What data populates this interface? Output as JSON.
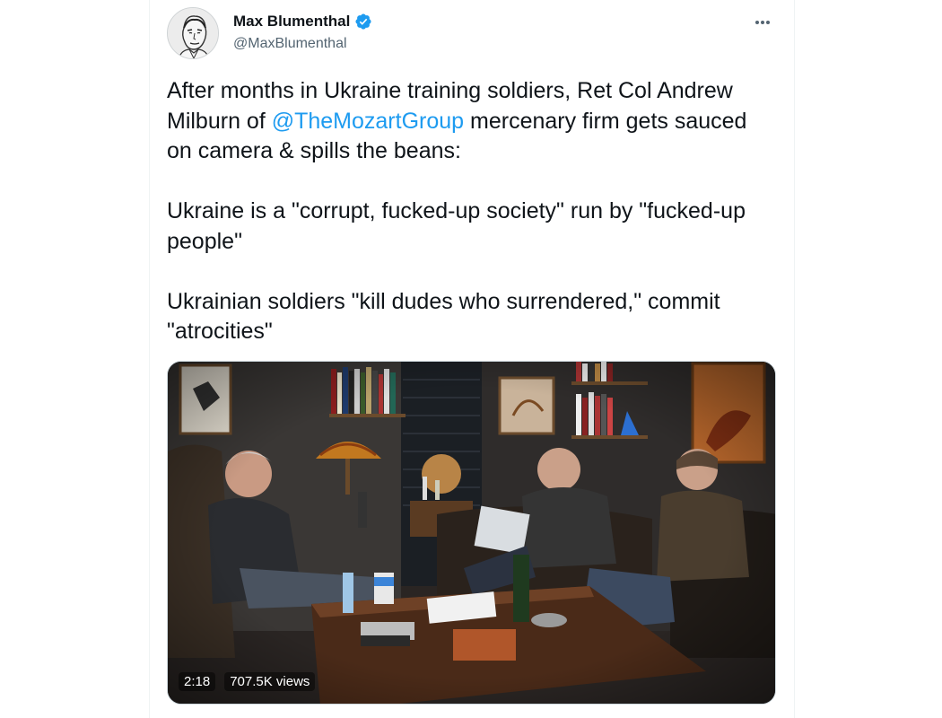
{
  "author": {
    "name": "Max Blumenthal",
    "handle": "@MaxBlumenthal",
    "verified": true,
    "verified_color": "#1d9bf0"
  },
  "menu": {
    "icon": "more-horizontal-icon"
  },
  "tweet": {
    "p1_before": "After months in Ukraine training soldiers, Ret Col Andrew Milburn of ",
    "p1_mention": "@TheMozartGroup",
    "p1_after": " mercenary firm gets sauced on camera & spills the beans:",
    "p2": "Ukraine is a \"corrupt, fucked-up society\" run by \"fucked-up people\"",
    "p3": "Ukrainian soldiers \"kill dudes who surrendered,\" commit \"atrocities\""
  },
  "video": {
    "duration": "2:18",
    "views": "707.5K views",
    "description": "video-thumbnail"
  },
  "colors": {
    "link": "#1d9bf0",
    "text": "#0f1419",
    "secondary": "#536471"
  }
}
